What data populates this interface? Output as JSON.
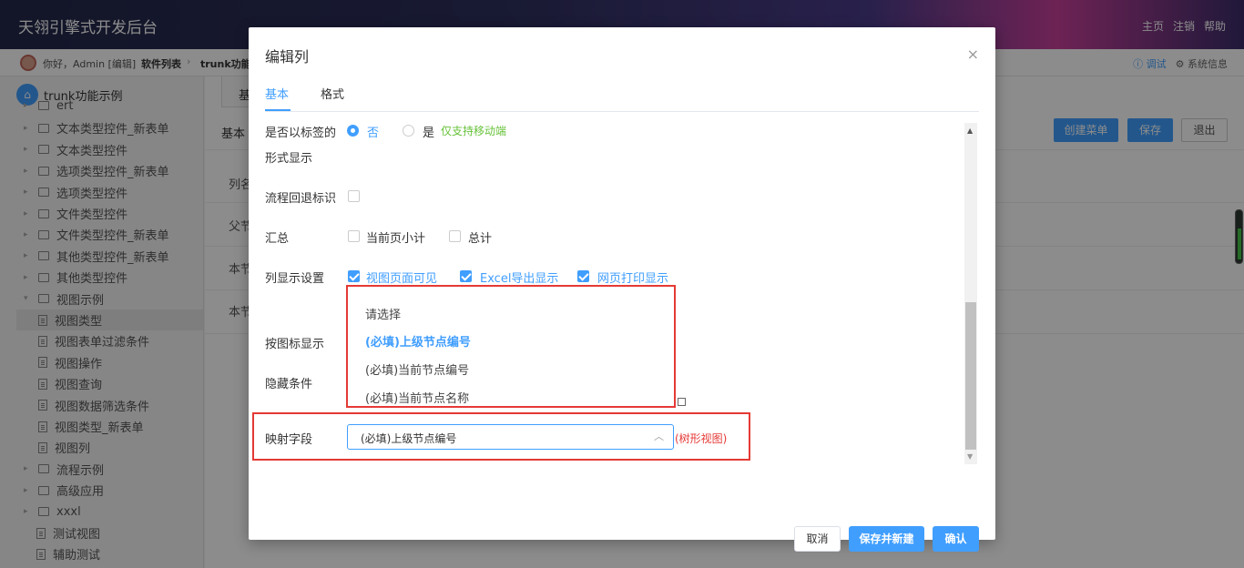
{
  "app": {
    "title": "天翎引擎式开发后台",
    "links": [
      "主页",
      "注销",
      "帮助"
    ]
  },
  "breadcrumb": {
    "greeting": "你好，Admin [编辑]",
    "item1": "软件列表",
    "separator": "›",
    "item2": "trunk功能示",
    "debug": "ⓘ 调试",
    "sysinfo": "⚙ 系统信息"
  },
  "sidebar": {
    "root": "trunk功能示例",
    "items": [
      {
        "label": "ert",
        "type": "folder"
      },
      {
        "label": "文本类型控件_新表单",
        "type": "folder"
      },
      {
        "label": "文本类型控件",
        "type": "folder"
      },
      {
        "label": "选项类型控件_新表单",
        "type": "folder"
      },
      {
        "label": "选项类型控件",
        "type": "folder"
      },
      {
        "label": "文件类型控件",
        "type": "folder"
      },
      {
        "label": "文件类型控件_新表单",
        "type": "folder"
      },
      {
        "label": "其他类型控件_新表单",
        "type": "folder"
      },
      {
        "label": "其他类型控件",
        "type": "folder"
      },
      {
        "label": "视图示例",
        "type": "folder-open"
      },
      {
        "label": "视图类型",
        "type": "doc"
      },
      {
        "label": "视图表单过滤条件",
        "type": "doc"
      },
      {
        "label": "视图操作",
        "type": "doc"
      },
      {
        "label": "视图查询",
        "type": "doc"
      },
      {
        "label": "视图数据筛选条件",
        "type": "doc"
      },
      {
        "label": "视图类型_新表单",
        "type": "doc"
      },
      {
        "label": "视图列",
        "type": "doc"
      },
      {
        "label": "流程示例",
        "type": "folder"
      },
      {
        "label": "高级应用",
        "type": "folder"
      },
      {
        "label": "xxxl",
        "type": "folder"
      },
      {
        "label": "测试视图",
        "type": "doc"
      },
      {
        "label": "辅助测试",
        "type": "doc"
      }
    ]
  },
  "background": {
    "tab": "基",
    "basic": "基本",
    "rows": [
      "列名",
      "父节",
      "本节",
      "本节"
    ],
    "buttons": {
      "create_menu": "创建菜单",
      "save": "保存",
      "exit": "退出"
    }
  },
  "modal": {
    "title": "编辑列",
    "close": "×",
    "tabs": [
      "基本",
      "格式"
    ],
    "fields": {
      "tag_display_label": "是否以标签的",
      "tag_display_label2": "形式显示",
      "tag_no": "否",
      "tag_yes": "是",
      "tag_note": "仅支持移动端",
      "flow_back_label": "流程回退标识",
      "summary_label": "汇总",
      "summary_page": "当前页小计",
      "summary_total": "总计",
      "col_display_label": "列显示设置",
      "col_display_view": "视图页面可见",
      "col_display_excel": "Excel导出显示",
      "col_display_print": "网页打印显示",
      "icon_display_label": "按图标显示",
      "hide_cond_label": "隐藏条件",
      "mapping_label": "映射字段",
      "mapping_value": "(必填)上级节点编号",
      "mapping_note": "(树形视图)"
    },
    "dropdown": [
      "请选择",
      "(必填)上级节点编号",
      "(必填)当前节点编号",
      "(必填)当前节点名称"
    ],
    "footer": {
      "cancel": "取消",
      "save_new": "保存并新建",
      "confirm": "确认"
    }
  },
  "colors": {
    "accent": "#409eff",
    "highlight": "#e53935",
    "note_green": "#67c23a"
  }
}
